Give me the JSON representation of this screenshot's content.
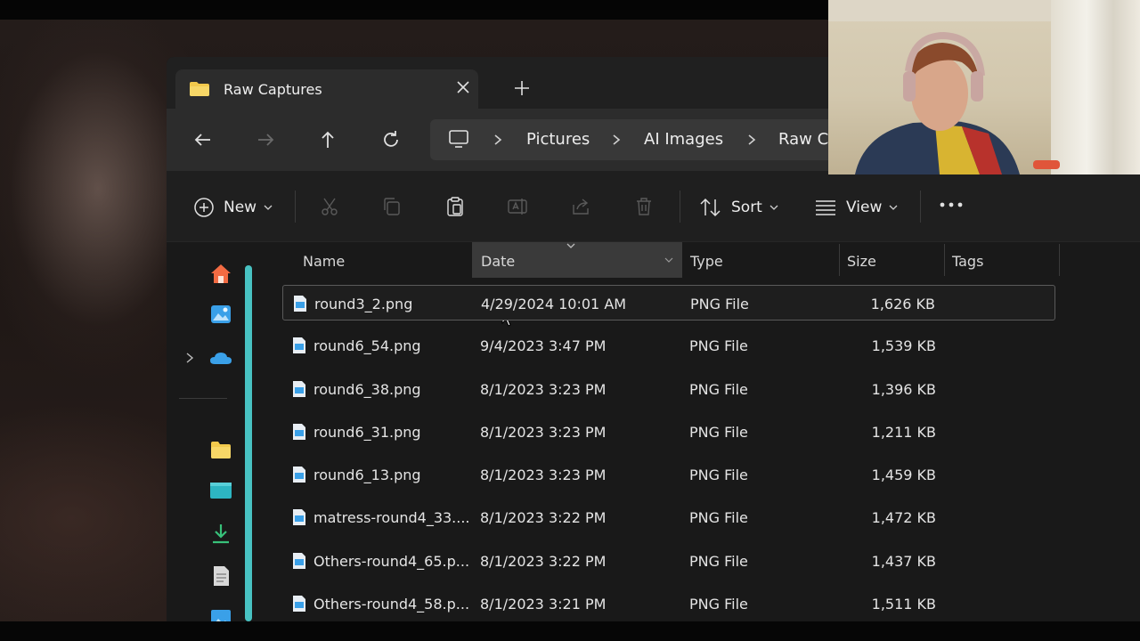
{
  "window": {
    "tab_title": "Raw Captures"
  },
  "breadcrumbs": [
    "Pictures",
    "AI Images",
    "Raw C"
  ],
  "toolbar": {
    "new_label": "New",
    "sort_label": "Sort",
    "view_label": "View"
  },
  "columns": {
    "name": "Name",
    "date": "Date",
    "type": "Type",
    "size": "Size",
    "tags": "Tags"
  },
  "files": [
    {
      "name": "round3_2.png",
      "date": "4/29/2024 10:01 AM",
      "type": "PNG File",
      "size": "1,626 KB"
    },
    {
      "name": "round6_54.png",
      "date": "9/4/2023 3:47 PM",
      "type": "PNG File",
      "size": "1,539 KB"
    },
    {
      "name": "round6_38.png",
      "date": "8/1/2023 3:23 PM",
      "type": "PNG File",
      "size": "1,396 KB"
    },
    {
      "name": "round6_31.png",
      "date": "8/1/2023 3:23 PM",
      "type": "PNG File",
      "size": "1,211 KB"
    },
    {
      "name": "round6_13.png",
      "date": "8/1/2023 3:23 PM",
      "type": "PNG File",
      "size": "1,459 KB"
    },
    {
      "name": "matress-round4_33....",
      "date": "8/1/2023 3:22 PM",
      "type": "PNG File",
      "size": "1,472 KB"
    },
    {
      "name": "Others-round4_65.p...",
      "date": "8/1/2023 3:22 PM",
      "type": "PNG File",
      "size": "1,437 KB"
    },
    {
      "name": "Others-round4_58.p...",
      "date": "8/1/2023 3:21 PM",
      "type": "PNG File",
      "size": "1,511 KB"
    }
  ],
  "colors": {
    "window_bg": "#191919",
    "accent_teal": "#48c2c2",
    "folder_yellow": "#f2c94c",
    "onedrive_blue": "#3aa0e8"
  },
  "icons": {
    "home": "home-icon",
    "gallery": "gallery-icon",
    "onedrive": "cloud-icon",
    "folder": "folder-icon",
    "desktop": "desktop-icon",
    "downloads": "download-icon",
    "documents": "document-icon",
    "pictures": "pictures-icon"
  }
}
